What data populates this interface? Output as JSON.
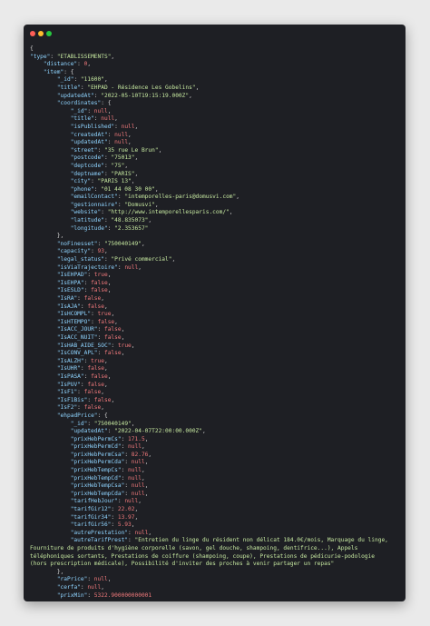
{
  "colors": {
    "background": "#eaeaea",
    "window": "#1e1f24",
    "key": "#8fd4ff",
    "string": "#c6e8a0",
    "number_null_bool": "#f0797b",
    "punctuation": "#d4d4d4",
    "dot_red": "#ff5f57",
    "dot_yellow": "#febc2e",
    "dot_green": "#28c840"
  },
  "lines": [
    [
      [
        "p",
        "{"
      ]
    ],
    [
      [
        "k",
        "\"type\""
      ],
      [
        "p",
        ": "
      ],
      [
        "s",
        "\"ETABLISSEMENTS\""
      ],
      [
        "p",
        ","
      ]
    ],
    [
      [
        "p",
        "    "
      ],
      [
        "k",
        "\"distance\""
      ],
      [
        "p",
        ": "
      ],
      [
        "n",
        "0"
      ],
      [
        "p",
        ","
      ]
    ],
    [
      [
        "p",
        "    "
      ],
      [
        "k",
        "\"item\""
      ],
      [
        "p",
        ": {"
      ]
    ],
    [
      [
        "p",
        "        "
      ],
      [
        "k",
        "\"_id\""
      ],
      [
        "p",
        ": "
      ],
      [
        "s",
        "\"11600\""
      ],
      [
        "p",
        ","
      ]
    ],
    [
      [
        "p",
        "        "
      ],
      [
        "k",
        "\"title\""
      ],
      [
        "p",
        ": "
      ],
      [
        "s",
        "\"EHPAD - Résidence Les Gobelins\""
      ],
      [
        "p",
        ","
      ]
    ],
    [
      [
        "p",
        "        "
      ],
      [
        "k",
        "\"updatedAt\""
      ],
      [
        "p",
        ": "
      ],
      [
        "s",
        "\"2022-05-10T19:15:19.000Z\""
      ],
      [
        "p",
        ","
      ]
    ],
    [
      [
        "p",
        "        "
      ],
      [
        "k",
        "\"coordinates\""
      ],
      [
        "p",
        ": {"
      ]
    ],
    [
      [
        "p",
        "            "
      ],
      [
        "k",
        "\"_id\""
      ],
      [
        "p",
        ": "
      ],
      [
        "n",
        "null"
      ],
      [
        "p",
        ","
      ]
    ],
    [
      [
        "p",
        "            "
      ],
      [
        "k",
        "\"title\""
      ],
      [
        "p",
        ": "
      ],
      [
        "n",
        "null"
      ],
      [
        "p",
        ","
      ]
    ],
    [
      [
        "p",
        "            "
      ],
      [
        "k",
        "\"isPublished\""
      ],
      [
        "p",
        ": "
      ],
      [
        "n",
        "null"
      ],
      [
        "p",
        ","
      ]
    ],
    [
      [
        "p",
        "            "
      ],
      [
        "k",
        "\"createdAt\""
      ],
      [
        "p",
        ": "
      ],
      [
        "n",
        "null"
      ],
      [
        "p",
        ","
      ]
    ],
    [
      [
        "p",
        "            "
      ],
      [
        "k",
        "\"updatedAt\""
      ],
      [
        "p",
        ": "
      ],
      [
        "n",
        "null"
      ],
      [
        "p",
        ","
      ]
    ],
    [
      [
        "p",
        "            "
      ],
      [
        "k",
        "\"street\""
      ],
      [
        "p",
        ": "
      ],
      [
        "s",
        "\"35 rue Le Brun\""
      ],
      [
        "p",
        ","
      ]
    ],
    [
      [
        "p",
        "            "
      ],
      [
        "k",
        "\"postcode\""
      ],
      [
        "p",
        ": "
      ],
      [
        "s",
        "\"75013\""
      ],
      [
        "p",
        ","
      ]
    ],
    [
      [
        "p",
        "            "
      ],
      [
        "k",
        "\"deptcode\""
      ],
      [
        "p",
        ": "
      ],
      [
        "s",
        "\"75\""
      ],
      [
        "p",
        ","
      ]
    ],
    [
      [
        "p",
        "            "
      ],
      [
        "k",
        "\"deptname\""
      ],
      [
        "p",
        ": "
      ],
      [
        "s",
        "\"PARIS\""
      ],
      [
        "p",
        ","
      ]
    ],
    [
      [
        "p",
        "            "
      ],
      [
        "k",
        "\"city\""
      ],
      [
        "p",
        ": "
      ],
      [
        "s",
        "\"PARIS 13\""
      ],
      [
        "p",
        ","
      ]
    ],
    [
      [
        "p",
        "            "
      ],
      [
        "k",
        "\"phone\""
      ],
      [
        "p",
        ": "
      ],
      [
        "s",
        "\"01 44 08 30 00\""
      ],
      [
        "p",
        ","
      ]
    ],
    [
      [
        "p",
        "            "
      ],
      [
        "k",
        "\"emailContact\""
      ],
      [
        "p",
        ": "
      ],
      [
        "s",
        "\"intemporelles-paris@domusvi.com\""
      ],
      [
        "p",
        ","
      ]
    ],
    [
      [
        "p",
        "            "
      ],
      [
        "k",
        "\"gestionnaire\""
      ],
      [
        "p",
        ": "
      ],
      [
        "s",
        "\"Domusvi\""
      ],
      [
        "p",
        ","
      ]
    ],
    [
      [
        "p",
        "            "
      ],
      [
        "k",
        "\"website\""
      ],
      [
        "p",
        ": "
      ],
      [
        "s",
        "\"http://www.intemporellesparis.com/\""
      ],
      [
        "p",
        ","
      ]
    ],
    [
      [
        "p",
        "            "
      ],
      [
        "k",
        "\"latitude\""
      ],
      [
        "p",
        ": "
      ],
      [
        "s",
        "\"48.835073\""
      ],
      [
        "p",
        ","
      ]
    ],
    [
      [
        "p",
        "            "
      ],
      [
        "k",
        "\"longitude\""
      ],
      [
        "p",
        ": "
      ],
      [
        "s",
        "\"2.353657\""
      ]
    ],
    [
      [
        "p",
        "        },"
      ]
    ],
    [
      [
        "p",
        "        "
      ],
      [
        "k",
        "\"noFinesset\""
      ],
      [
        "p",
        ": "
      ],
      [
        "s",
        "\"750040149\""
      ],
      [
        "p",
        ","
      ]
    ],
    [
      [
        "p",
        "        "
      ],
      [
        "k",
        "\"capacity\""
      ],
      [
        "p",
        ": "
      ],
      [
        "n",
        "93"
      ],
      [
        "p",
        ","
      ]
    ],
    [
      [
        "p",
        "        "
      ],
      [
        "k",
        "\"legal_status\""
      ],
      [
        "p",
        ": "
      ],
      [
        "s",
        "\"Privé commercial\""
      ],
      [
        "p",
        ","
      ]
    ],
    [
      [
        "p",
        "        "
      ],
      [
        "k",
        "\"isViaTrajectoire\""
      ],
      [
        "p",
        ": "
      ],
      [
        "n",
        "null"
      ],
      [
        "p",
        ","
      ]
    ],
    [
      [
        "p",
        "        "
      ],
      [
        "k",
        "\"IsEHPAD\""
      ],
      [
        "p",
        ": "
      ],
      [
        "n",
        "true"
      ],
      [
        "p",
        ","
      ]
    ],
    [
      [
        "p",
        "        "
      ],
      [
        "k",
        "\"IsEHPA\""
      ],
      [
        "p",
        ": "
      ],
      [
        "n",
        "false"
      ],
      [
        "p",
        ","
      ]
    ],
    [
      [
        "p",
        "        "
      ],
      [
        "k",
        "\"IsESLD\""
      ],
      [
        "p",
        ": "
      ],
      [
        "n",
        "false"
      ],
      [
        "p",
        ","
      ]
    ],
    [
      [
        "p",
        "        "
      ],
      [
        "k",
        "\"IsRA\""
      ],
      [
        "p",
        ": "
      ],
      [
        "n",
        "false"
      ],
      [
        "p",
        ","
      ]
    ],
    [
      [
        "p",
        "        "
      ],
      [
        "k",
        "\"IsAJA\""
      ],
      [
        "p",
        ": "
      ],
      [
        "n",
        "false"
      ],
      [
        "p",
        ","
      ]
    ],
    [
      [
        "p",
        "        "
      ],
      [
        "k",
        "\"IsHCOMPL\""
      ],
      [
        "p",
        ": "
      ],
      [
        "n",
        "true"
      ],
      [
        "p",
        ","
      ]
    ],
    [
      [
        "p",
        "        "
      ],
      [
        "k",
        "\"IsHTEMPO\""
      ],
      [
        "p",
        ": "
      ],
      [
        "n",
        "false"
      ],
      [
        "p",
        ","
      ]
    ],
    [
      [
        "p",
        "        "
      ],
      [
        "k",
        "\"IsACC_JOUR\""
      ],
      [
        "p",
        ": "
      ],
      [
        "n",
        "false"
      ],
      [
        "p",
        ","
      ]
    ],
    [
      [
        "p",
        "        "
      ],
      [
        "k",
        "\"IsACC_NUIT\""
      ],
      [
        "p",
        ": "
      ],
      [
        "n",
        "false"
      ],
      [
        "p",
        ","
      ]
    ],
    [
      [
        "p",
        "        "
      ],
      [
        "k",
        "\"IsHAB_AIDE_SOC\""
      ],
      [
        "p",
        ": "
      ],
      [
        "n",
        "true"
      ],
      [
        "p",
        ","
      ]
    ],
    [
      [
        "p",
        "        "
      ],
      [
        "k",
        "\"IsCONV_APL\""
      ],
      [
        "p",
        ": "
      ],
      [
        "n",
        "false"
      ],
      [
        "p",
        ","
      ]
    ],
    [
      [
        "p",
        "        "
      ],
      [
        "k",
        "\"IsALZH\""
      ],
      [
        "p",
        ": "
      ],
      [
        "n",
        "true"
      ],
      [
        "p",
        ","
      ]
    ],
    [
      [
        "p",
        "        "
      ],
      [
        "k",
        "\"IsUHR\""
      ],
      [
        "p",
        ": "
      ],
      [
        "n",
        "false"
      ],
      [
        "p",
        ","
      ]
    ],
    [
      [
        "p",
        "        "
      ],
      [
        "k",
        "\"IsPASA\""
      ],
      [
        "p",
        ": "
      ],
      [
        "n",
        "false"
      ],
      [
        "p",
        ","
      ]
    ],
    [
      [
        "p",
        "        "
      ],
      [
        "k",
        "\"IsPUV\""
      ],
      [
        "p",
        ": "
      ],
      [
        "n",
        "false"
      ],
      [
        "p",
        ","
      ]
    ],
    [
      [
        "p",
        "        "
      ],
      [
        "k",
        "\"IsF1\""
      ],
      [
        "p",
        ": "
      ],
      [
        "n",
        "false"
      ],
      [
        "p",
        ","
      ]
    ],
    [
      [
        "p",
        "        "
      ],
      [
        "k",
        "\"IsF1Bis\""
      ],
      [
        "p",
        ": "
      ],
      [
        "n",
        "false"
      ],
      [
        "p",
        ","
      ]
    ],
    [
      [
        "p",
        "        "
      ],
      [
        "k",
        "\"IsF2\""
      ],
      [
        "p",
        ": "
      ],
      [
        "n",
        "false"
      ],
      [
        "p",
        ","
      ]
    ],
    [
      [
        "p",
        "        "
      ],
      [
        "k",
        "\"ehpadPrice\""
      ],
      [
        "p",
        ": {"
      ]
    ],
    [
      [
        "p",
        "            "
      ],
      [
        "k",
        "\"_id\""
      ],
      [
        "p",
        ": "
      ],
      [
        "s",
        "\"750040149\""
      ],
      [
        "p",
        ","
      ]
    ],
    [
      [
        "p",
        "            "
      ],
      [
        "k",
        "\"updatedAt\""
      ],
      [
        "p",
        ": "
      ],
      [
        "s",
        "\"2022-04-07T22:00:00.000Z\""
      ],
      [
        "p",
        ","
      ]
    ],
    [
      [
        "p",
        "            "
      ],
      [
        "k",
        "\"prixHebPermCs\""
      ],
      [
        "p",
        ": "
      ],
      [
        "n",
        "171.5"
      ],
      [
        "p",
        ","
      ]
    ],
    [
      [
        "p",
        "            "
      ],
      [
        "k",
        "\"prixHebPermCd\""
      ],
      [
        "p",
        ": "
      ],
      [
        "n",
        "null"
      ],
      [
        "p",
        ","
      ]
    ],
    [
      [
        "p",
        "            "
      ],
      [
        "k",
        "\"prixHebPermCsa\""
      ],
      [
        "p",
        ": "
      ],
      [
        "n",
        "82.76"
      ],
      [
        "p",
        ","
      ]
    ],
    [
      [
        "p",
        "            "
      ],
      [
        "k",
        "\"prixHebPermCda\""
      ],
      [
        "p",
        ": "
      ],
      [
        "n",
        "null"
      ],
      [
        "p",
        ","
      ]
    ],
    [
      [
        "p",
        "            "
      ],
      [
        "k",
        "\"prixHebTempCs\""
      ],
      [
        "p",
        ": "
      ],
      [
        "n",
        "null"
      ],
      [
        "p",
        ","
      ]
    ],
    [
      [
        "p",
        "            "
      ],
      [
        "k",
        "\"prixHebTempCd\""
      ],
      [
        "p",
        ": "
      ],
      [
        "n",
        "null"
      ],
      [
        "p",
        ","
      ]
    ],
    [
      [
        "p",
        "            "
      ],
      [
        "k",
        "\"prixHebTempCsa\""
      ],
      [
        "p",
        ": "
      ],
      [
        "n",
        "null"
      ],
      [
        "p",
        ","
      ]
    ],
    [
      [
        "p",
        "            "
      ],
      [
        "k",
        "\"prixHebTempCda\""
      ],
      [
        "p",
        ": "
      ],
      [
        "n",
        "null"
      ],
      [
        "p",
        ","
      ]
    ],
    [
      [
        "p",
        "            "
      ],
      [
        "k",
        "\"tarifHebJour\""
      ],
      [
        "p",
        ": "
      ],
      [
        "n",
        "null"
      ],
      [
        "p",
        ","
      ]
    ],
    [
      [
        "p",
        "            "
      ],
      [
        "k",
        "\"tarifGir12\""
      ],
      [
        "p",
        ": "
      ],
      [
        "n",
        "22.02"
      ],
      [
        "p",
        ","
      ]
    ],
    [
      [
        "p",
        "            "
      ],
      [
        "k",
        "\"tarifGir34\""
      ],
      [
        "p",
        ": "
      ],
      [
        "n",
        "13.97"
      ],
      [
        "p",
        ","
      ]
    ],
    [
      [
        "p",
        "            "
      ],
      [
        "k",
        "\"tarifGir56\""
      ],
      [
        "p",
        ": "
      ],
      [
        "n",
        "5.93"
      ],
      [
        "p",
        ","
      ]
    ],
    [
      [
        "p",
        "            "
      ],
      [
        "k",
        "\"autrePrestation\""
      ],
      [
        "p",
        ": "
      ],
      [
        "n",
        "null"
      ],
      [
        "p",
        ","
      ]
    ],
    [
      [
        "p",
        "            "
      ],
      [
        "k",
        "\"autreTarifPrest\""
      ],
      [
        "p",
        ": "
      ],
      [
        "s",
        "\"Entretien du linge du résident non délicat 184.0€/mois, Marquage du linge,"
      ]
    ],
    [
      [
        "s",
        "Fourniture de produits d'hygiène corporelle (savon, gel douche, shampoing, dentifrice...), Appels"
      ]
    ],
    [
      [
        "s",
        "téléphoniques sortants, Prestations de coiffure (shampoing, coupe), Prestations de pédicurie-podologie"
      ]
    ],
    [
      [
        "s",
        "(hors prescription médicale), Possibilité d'inviter des proches à venir partager un repas\""
      ]
    ],
    [
      [
        "p",
        "        },"
      ]
    ],
    [
      [
        "p",
        "        "
      ],
      [
        "k",
        "\"raPrice\""
      ],
      [
        "p",
        ": "
      ],
      [
        "n",
        "null"
      ],
      [
        "p",
        ","
      ]
    ],
    [
      [
        "p",
        "        "
      ],
      [
        "k",
        "\"cerfa\""
      ],
      [
        "p",
        ": "
      ],
      [
        "n",
        "null"
      ],
      [
        "p",
        ","
      ]
    ],
    [
      [
        "p",
        "        "
      ],
      [
        "k",
        "\"prixMin\""
      ],
      [
        "p",
        ": "
      ],
      [
        "n",
        "5322.900000000001"
      ]
    ]
  ]
}
